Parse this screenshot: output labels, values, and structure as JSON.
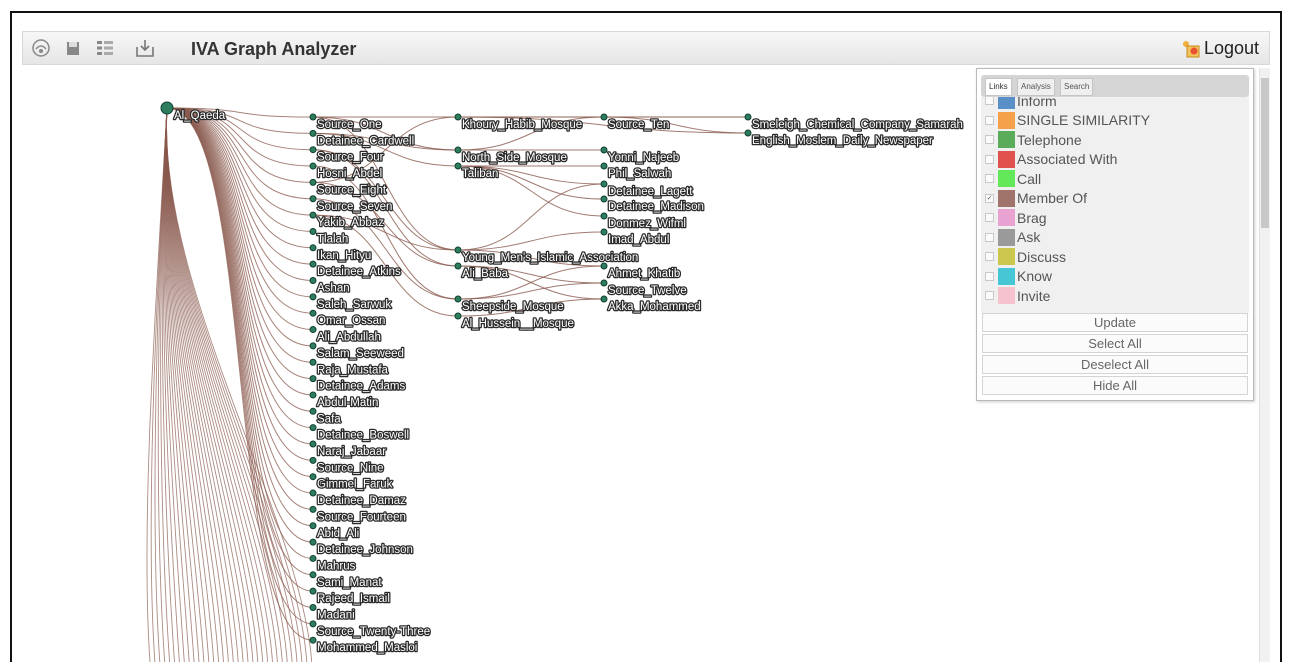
{
  "app": {
    "title": "IVA Graph Analyzer",
    "logout_label": "Logout"
  },
  "toolbar": {
    "buttons": [
      {
        "icon": "layout-icon"
      },
      {
        "icon": "save-icon"
      },
      {
        "icon": "list-icon"
      },
      {
        "icon": "export-icon"
      }
    ]
  },
  "graph": {
    "root": "Al_Qaeda",
    "columns": [
      [
        "Source_One",
        "Detainee_Cardwell",
        "Source_Four",
        "Hosni_Abdel",
        "Source_Eight",
        "Source_Seven",
        "Yakib_Abbaz",
        "Tlalah",
        "Ikan_Hityu",
        "Detainee_Atkins",
        "Ashan",
        "Saleh_Sarwuk",
        "Omar_Ossan",
        "Ali_Abdullah",
        "Salam_Seeweed",
        "Raja_Mustafa",
        "Detainee_Adams",
        "Abdul-Matin",
        "Safa",
        "Detainee_Boswell",
        "Naraj_Jabaar",
        "Source_Nine",
        "Gimmel_Faruk",
        "Detainee_Damaz",
        "Source_Fourteen",
        "Abid_Ali",
        "Detainee_Johnson",
        "Mahrus",
        "Sami_Manat",
        "Rajeed_Ismail",
        "Madani",
        "Source_Twenty-Three",
        "Mohammed_Masloi"
      ],
      [
        "Khoury_Habib_Mosque",
        "North_Side_Mosque",
        "Taliban",
        "Young_Men's_Islamic_Association",
        "Ali_Baba",
        "Sheepside_Mosque",
        "Al_Hussein__Mosque"
      ],
      [
        "Source_Ten",
        "Yonni_Najeeb",
        "Phil_Salwah",
        "Detainee_Lagett",
        "Detainee_Madison",
        "Donmez_Wifml",
        "Imad_Abdul",
        "Ahmet_Khatib",
        "Source_Twelve",
        "Akka_Mohammed"
      ],
      [
        "Smeleigh_Chemical_Company_Samarah",
        "English_Moslem_Daily_Newspaper"
      ]
    ]
  },
  "panel": {
    "tabs": [
      "Links",
      "Analysis",
      "Search"
    ],
    "active_tab": "Links",
    "link_types": [
      {
        "label": "Inform",
        "color": "#5b8fc7",
        "checked": false
      },
      {
        "label": "SINGLE SIMILARITY",
        "color": "#f5a04a",
        "checked": false
      },
      {
        "label": "Telephone",
        "color": "#5aab5a",
        "checked": false
      },
      {
        "label": "Associated With",
        "color": "#e0504c",
        "checked": false
      },
      {
        "label": "Call",
        "color": "#63e85a",
        "checked": false
      },
      {
        "label": "Member Of",
        "color": "#a0736b",
        "checked": true
      },
      {
        "label": "Brag",
        "color": "#e9a3d3",
        "checked": false
      },
      {
        "label": "Ask",
        "color": "#9a9a9a",
        "checked": false
      },
      {
        "label": "Discuss",
        "color": "#cbc64e",
        "checked": false
      },
      {
        "label": "Know",
        "color": "#47c7d6",
        "checked": false
      },
      {
        "label": "Invite",
        "color": "#f6c2ce",
        "checked": false
      }
    ],
    "buttons": {
      "update": "Update",
      "select_all": "Select All",
      "deselect_all": "Deselect All",
      "hide_all": "Hide All"
    }
  },
  "colors": {
    "edge": "#8a5a4e",
    "node": "#2e7d5f"
  }
}
